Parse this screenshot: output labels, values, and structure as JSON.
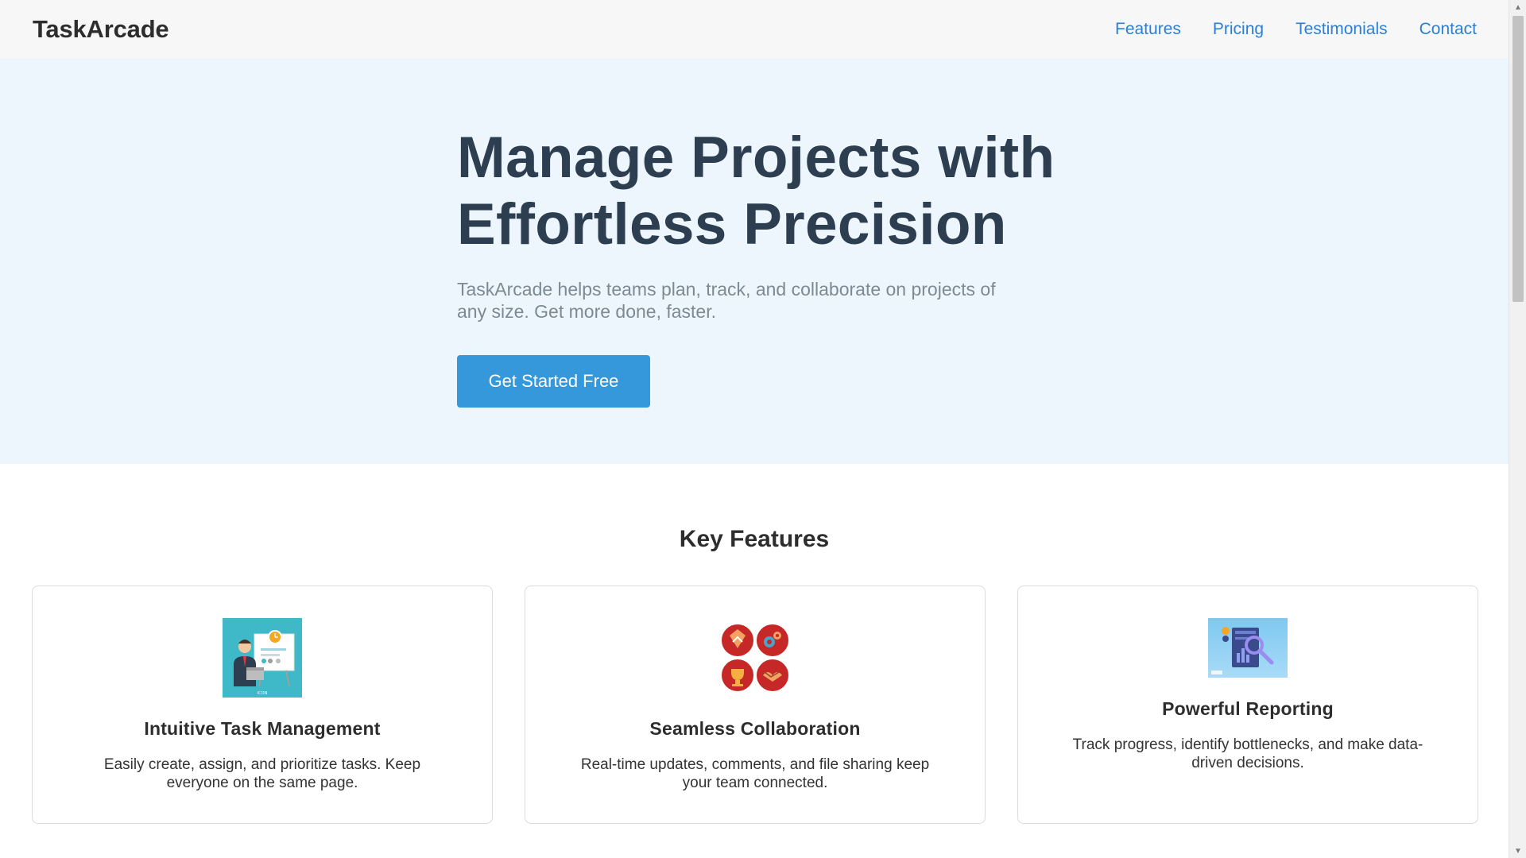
{
  "header": {
    "logo": "TaskArcade",
    "nav": [
      "Features",
      "Pricing",
      "Testimonials",
      "Contact"
    ]
  },
  "hero": {
    "title_line1": "Manage Projects with",
    "title_line2": "Effortless Precision",
    "subtitle": "TaskArcade helps teams plan, track, and collaborate on projects of any size. Get more done, faster.",
    "cta_label": "Get Started Free"
  },
  "features": {
    "heading": "Key Features",
    "cards": [
      {
        "icon": "presentation-businessman-icon",
        "title": "Intuitive Task Management",
        "description": "Easily create, assign, and prioritize tasks. Keep everyone on the same page."
      },
      {
        "icon": "teamwork-circles-icon",
        "title": "Seamless Collaboration",
        "description": "Real-time updates, comments, and file sharing keep your team connected."
      },
      {
        "icon": "report-magnifier-icon",
        "title": "Powerful Reporting",
        "description": "Track progress, identify bottlenecks, and make data-driven decisions."
      }
    ]
  },
  "colors": {
    "accent": "#3498db",
    "link": "#2b7fd4",
    "hero_bg": "#eef6fd",
    "heading": "#2c3e50"
  }
}
